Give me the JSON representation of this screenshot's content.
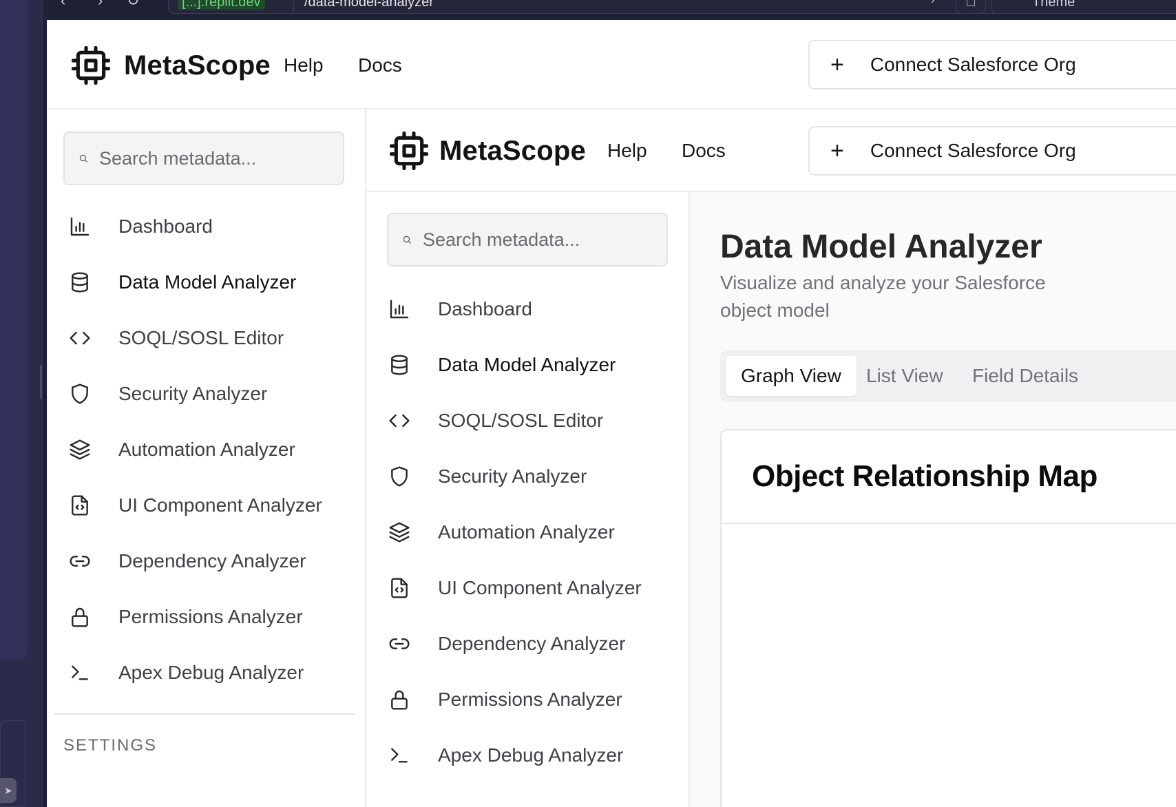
{
  "browser": {
    "url_host": "[...].replit.dev",
    "url_path": "/data-model-analyzer",
    "theme_label": "Theme"
  },
  "app": {
    "brand": "MetaScope",
    "top_links": [
      "Help",
      "Docs"
    ],
    "connect_button": "Connect Salesforce Org",
    "search_placeholder": "Search metadata...",
    "nav": [
      {
        "label": "Dashboard",
        "icon": "bar-chart-icon"
      },
      {
        "label": "Data Model Analyzer",
        "icon": "database-icon",
        "active": true
      },
      {
        "label": "SOQL/SOSL Editor",
        "icon": "code-icon"
      },
      {
        "label": "Security Analyzer",
        "icon": "shield-icon"
      },
      {
        "label": "Automation Analyzer",
        "icon": "layers-icon"
      },
      {
        "label": "UI Component Analyzer",
        "icon": "file-code-icon"
      },
      {
        "label": "Dependency Analyzer",
        "icon": "link-icon"
      },
      {
        "label": "Permissions Analyzer",
        "icon": "lock-icon"
      },
      {
        "label": "Apex Debug Analyzer",
        "icon": "terminal-icon"
      }
    ],
    "settings_label": "SETTINGS"
  },
  "inner": {
    "brand": "MetaScope",
    "top_links": [
      "Help",
      "Docs"
    ],
    "connect_button": "Connect Salesforce Org",
    "search_placeholder": "Search metadata...",
    "nav": [
      {
        "label": "Dashboard"
      },
      {
        "label": "Data Model Analyzer"
      },
      {
        "label": "SOQL/SOSL Editor"
      },
      {
        "label": "Security Analyzer"
      },
      {
        "label": "Automation Analyzer"
      },
      {
        "label": "UI Component Analyzer"
      },
      {
        "label": "Dependency Analyzer"
      },
      {
        "label": "Permissions Analyzer"
      },
      {
        "label": "Apex Debug Analyzer"
      }
    ],
    "page_title": "Data Model Analyzer",
    "page_subtitle": "Visualize and analyze your Salesforce object model",
    "tabs": [
      {
        "label": "Graph View",
        "active": true
      },
      {
        "label": "List View"
      },
      {
        "label": "Field Details"
      }
    ],
    "card_title": "Object Relationship Map"
  }
}
